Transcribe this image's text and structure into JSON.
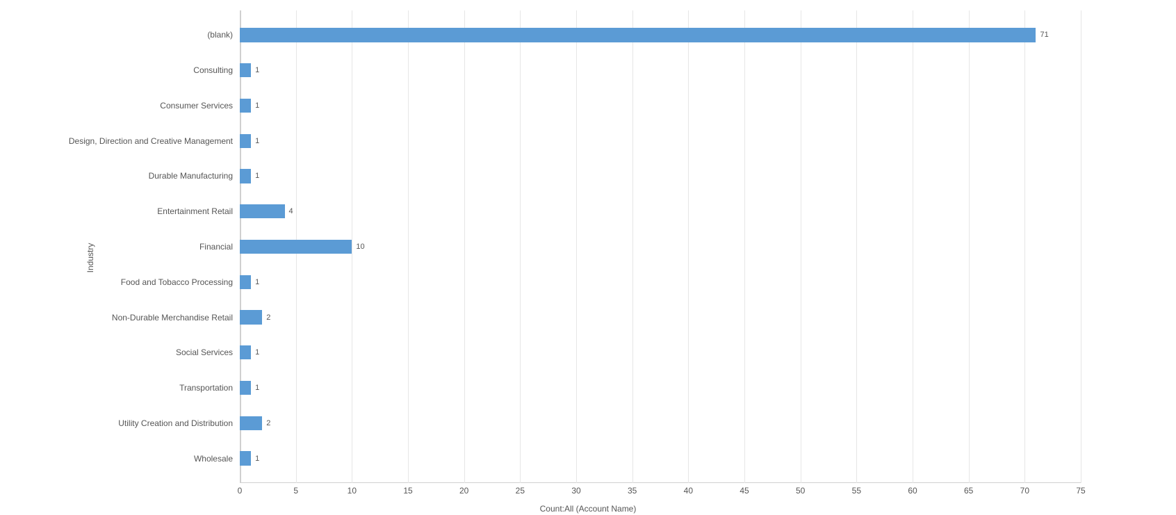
{
  "chart_data": {
    "type": "bar",
    "orientation": "horizontal",
    "categories": [
      "(blank)",
      "Consulting",
      "Consumer Services",
      "Design, Direction and Creative Management",
      "Durable Manufacturing",
      "Entertainment Retail",
      "Financial",
      "Food and Tobacco Processing",
      "Non-Durable Merchandise Retail",
      "Social Services",
      "Transportation",
      "Utility Creation and Distribution",
      "Wholesale"
    ],
    "values": [
      71,
      1,
      1,
      1,
      1,
      4,
      10,
      1,
      2,
      1,
      1,
      2,
      1
    ],
    "xlabel": "Count:All (Account Name)",
    "ylabel": "Industry",
    "xlim": [
      0,
      75
    ],
    "x_ticks": [
      0,
      5,
      10,
      15,
      20,
      25,
      30,
      35,
      40,
      45,
      50,
      55,
      60,
      65,
      70,
      75
    ],
    "bar_color": "#5b9bd5"
  }
}
